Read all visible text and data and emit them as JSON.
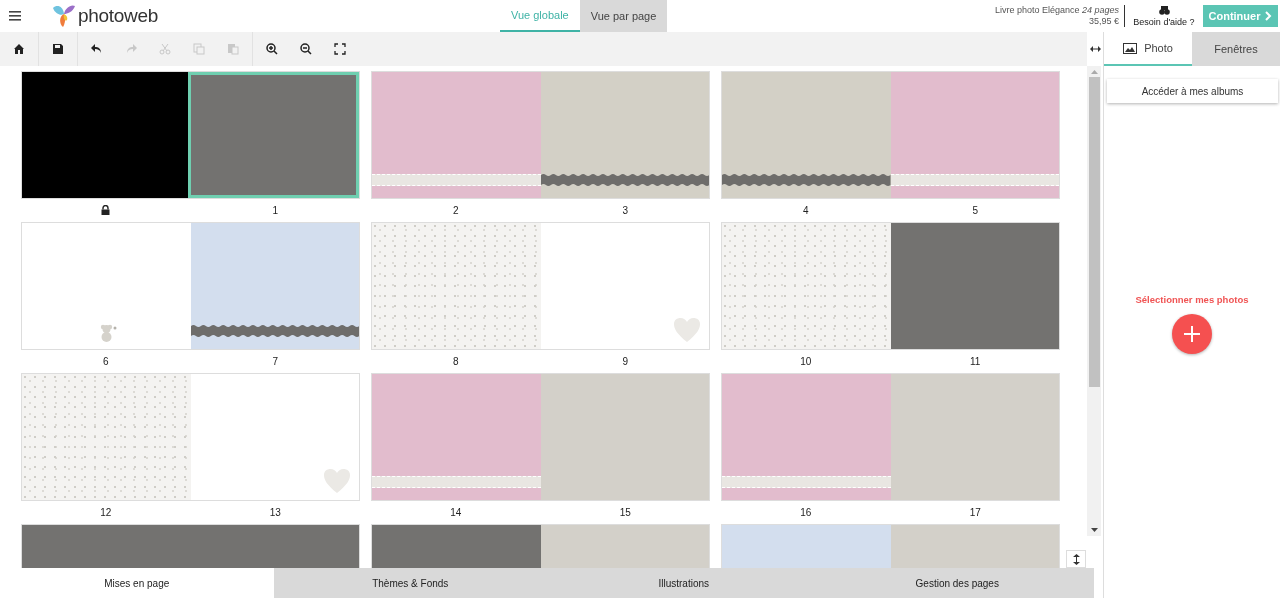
{
  "header": {
    "logo": "photoweb",
    "view_tabs": [
      {
        "label": "Vue globale",
        "selected": true
      },
      {
        "label": "Vue par page",
        "selected": false
      }
    ],
    "product": "Livre photo Elégance *24 pages*",
    "price": "35,95 €",
    "help": "Besoin d'aide ?",
    "continue": "Continuer"
  },
  "toolbar": [
    [
      {
        "kind": "home",
        "disabled": false
      }
    ],
    [
      {
        "kind": "save",
        "disabled": false
      }
    ],
    [
      {
        "kind": "undo",
        "disabled": false
      },
      {
        "kind": "redo",
        "disabled": true
      },
      {
        "kind": "cut",
        "disabled": true
      },
      {
        "kind": "copy",
        "disabled": true
      },
      {
        "kind": "paste",
        "disabled": true
      }
    ],
    [
      {
        "kind": "zoom_in",
        "disabled": false
      },
      {
        "kind": "zoom_out",
        "disabled": false
      },
      {
        "kind": "fit",
        "disabled": false
      }
    ]
  ],
  "spreads": [
    {
      "pages": [
        {
          "locked": true,
          "color": "#000000",
          "texture": false,
          "kind": "plain",
          "selected": false
        },
        {
          "label": "1",
          "locked": false,
          "color": "#737270",
          "texture": false,
          "kind": "plain",
          "selected": true
        }
      ]
    },
    {
      "pages": [
        {
          "label": "2",
          "locked": false,
          "color": "#e2bccd",
          "texture": false,
          "kind": "ribbon",
          "selected": false
        },
        {
          "label": "3",
          "locked": false,
          "color": "#d3d0c6",
          "texture": false,
          "kind": "lace",
          "selected": false
        }
      ]
    },
    {
      "pages": [
        {
          "label": "4",
          "locked": false,
          "color": "#d3d0c6",
          "texture": false,
          "kind": "lace",
          "selected": false
        },
        {
          "label": "5",
          "locked": false,
          "color": "#e2bccd",
          "texture": false,
          "kind": "ribbon",
          "selected": false
        }
      ]
    },
    {
      "pages": [
        {
          "label": "6",
          "locked": false,
          "color": "#ffffff",
          "texture": false,
          "kind": "bear",
          "selected": false
        },
        {
          "label": "7",
          "locked": false,
          "color": "#d3deee",
          "texture": false,
          "kind": "lace",
          "selected": false
        }
      ]
    },
    {
      "pages": [
        {
          "label": "8",
          "locked": false,
          "color": "#f4f3f1",
          "texture": true,
          "kind": "plain",
          "selected": false
        },
        {
          "label": "9",
          "locked": false,
          "color": "#ffffff",
          "texture": false,
          "kind": "heart",
          "selected": false
        }
      ]
    },
    {
      "pages": [
        {
          "label": "10",
          "locked": false,
          "color": "#f4f3f1",
          "texture": true,
          "kind": "plain",
          "selected": false
        },
        {
          "label": "11",
          "locked": false,
          "color": "#737270",
          "texture": false,
          "kind": "plain",
          "selected": false
        }
      ]
    },
    {
      "pages": [
        {
          "label": "12",
          "locked": false,
          "color": "#f4f3f1",
          "texture": true,
          "kind": "plain",
          "selected": false
        },
        {
          "label": "13",
          "locked": false,
          "color": "#ffffff",
          "texture": false,
          "kind": "heart",
          "selected": false
        }
      ]
    },
    {
      "pages": [
        {
          "label": "14",
          "locked": false,
          "color": "#e2bccd",
          "texture": false,
          "kind": "ribbon",
          "selected": false
        },
        {
          "label": "15",
          "locked": false,
          "color": "#d3d0c9",
          "texture": false,
          "kind": "plain",
          "selected": false
        }
      ]
    },
    {
      "pages": [
        {
          "label": "16",
          "locked": false,
          "color": "#e2bccd",
          "texture": false,
          "kind": "ribbon",
          "selected": false
        },
        {
          "label": "17",
          "locked": false,
          "color": "#d3d0c9",
          "texture": false,
          "kind": "plain",
          "selected": false
        }
      ]
    },
    {
      "pages": [
        {
          "color": "#737270",
          "texture": false,
          "kind": "plain",
          "selected": false
        },
        {
          "color": "#737270",
          "texture": false,
          "kind": "plain",
          "selected": false
        }
      ]
    },
    {
      "pages": [
        {
          "color": "#737270",
          "texture": false,
          "kind": "plain",
          "selected": false
        },
        {
          "color": "#d3d0c9",
          "texture": false,
          "kind": "plain",
          "selected": false
        }
      ]
    },
    {
      "pages": [
        {
          "color": "#d3deee",
          "texture": false,
          "kind": "plain",
          "selected": false
        },
        {
          "color": "#d3d0c9",
          "texture": false,
          "kind": "plain",
          "selected": false
        }
      ]
    }
  ],
  "bottom_tabs": [
    {
      "label": "Mises en page",
      "selected": true
    },
    {
      "label": "Thèmes & Fonds",
      "selected": false
    },
    {
      "label": "Illustrations",
      "selected": false
    },
    {
      "label": "Gestion des pages",
      "selected": false
    }
  ],
  "panel": {
    "tabs": [
      {
        "label": "Photo",
        "selected": true
      },
      {
        "label": "Fenêtres",
        "selected": false
      }
    ],
    "albums_button": "Accéder à mes albums",
    "select_label": "Sélectionner mes photos"
  }
}
